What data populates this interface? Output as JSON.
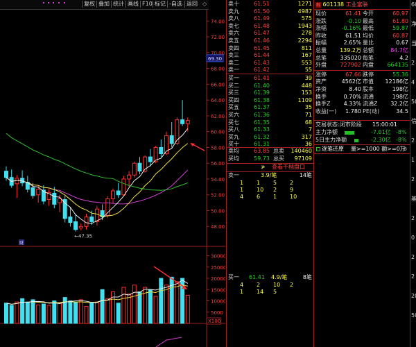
{
  "toolbar": {
    "items": [
      "复权",
      "叠加",
      "统计",
      "画线",
      "F10",
      "标记",
      "-自选",
      "返回"
    ],
    "diamond": "◇"
  },
  "chart": {
    "price_axis": [
      "74.00",
      "72.00",
      "70.00",
      "68.00",
      "66.00",
      "64.00",
      "62.00",
      "60.00",
      "58.00",
      "56.00",
      "54.00",
      "52.00",
      "50.00",
      "48.00"
    ],
    "price_tag": "69.30",
    "low_label": "←47.35",
    "cai_label": "财",
    "volume_axis": [
      "30000",
      "25000",
      "20000",
      "15000",
      "10000",
      "5000"
    ],
    "volume_unit": "X100",
    "colors": {
      "up": "#ff3030",
      "down": "#40e0f0",
      "ma5": "#f0f0f0",
      "ma10": "#f0e040",
      "ma20": "#d040d0",
      "ma60": "#30c030",
      "arrow": "#ff3030"
    }
  },
  "chart_data": {
    "type": "candlestick",
    "y_range": [
      46,
      75
    ],
    "candles": [
      {
        "o": 55.0,
        "h": 55.6,
        "l": 53.8,
        "c": 54.2
      },
      {
        "o": 54.2,
        "h": 55.2,
        "l": 52.9,
        "c": 53.2
      },
      {
        "o": 53.4,
        "h": 54.5,
        "l": 51.6,
        "c": 54.1
      },
      {
        "o": 54.1,
        "h": 55.1,
        "l": 53.1,
        "c": 53.5
      },
      {
        "o": 53.6,
        "h": 54.4,
        "l": 52.3,
        "c": 52.7
      },
      {
        "o": 52.9,
        "h": 53.5,
        "l": 51.5,
        "c": 51.9
      },
      {
        "o": 52.0,
        "h": 53.1,
        "l": 51.0,
        "c": 52.7
      },
      {
        "o": 52.6,
        "h": 53.2,
        "l": 50.8,
        "c": 51.2
      },
      {
        "o": 51.4,
        "h": 52.7,
        "l": 50.6,
        "c": 52.3
      },
      {
        "o": 52.2,
        "h": 53.0,
        "l": 50.3,
        "c": 50.8
      },
      {
        "o": 51.0,
        "h": 52.0,
        "l": 49.8,
        "c": 51.5
      },
      {
        "o": 51.4,
        "h": 51.9,
        "l": 48.5,
        "c": 49.0
      },
      {
        "o": 49.2,
        "h": 50.5,
        "l": 48.0,
        "c": 48.5
      },
      {
        "o": 48.6,
        "h": 49.5,
        "l": 47.35,
        "c": 47.6
      },
      {
        "o": 47.8,
        "h": 48.4,
        "l": 47.5,
        "c": 48.0
      },
      {
        "o": 48.0,
        "h": 49.6,
        "l": 47.6,
        "c": 49.2
      },
      {
        "o": 49.2,
        "h": 50.0,
        "l": 48.2,
        "c": 48.6
      },
      {
        "o": 48.6,
        "h": 50.6,
        "l": 48.1,
        "c": 50.2
      },
      {
        "o": 50.0,
        "h": 50.8,
        "l": 48.8,
        "c": 49.2
      },
      {
        "o": 49.4,
        "h": 51.8,
        "l": 49.1,
        "c": 51.5
      },
      {
        "o": 51.5,
        "h": 52.8,
        "l": 50.9,
        "c": 52.5
      },
      {
        "o": 52.5,
        "h": 53.5,
        "l": 51.6,
        "c": 52.0
      },
      {
        "o": 52.0,
        "h": 54.4,
        "l": 51.8,
        "c": 54.0
      },
      {
        "o": 54.0,
        "h": 55.0,
        "l": 53.0,
        "c": 54.5
      },
      {
        "o": 54.5,
        "h": 56.2,
        "l": 54.2,
        "c": 56.0
      },
      {
        "o": 56.0,
        "h": 56.8,
        "l": 54.6,
        "c": 55.0
      },
      {
        "o": 55.0,
        "h": 57.0,
        "l": 54.8,
        "c": 56.8
      },
      {
        "o": 56.8,
        "h": 57.8,
        "l": 55.6,
        "c": 56.2
      },
      {
        "o": 56.2,
        "h": 58.2,
        "l": 56.0,
        "c": 58.0
      },
      {
        "o": 58.0,
        "h": 59.0,
        "l": 56.8,
        "c": 57.2
      },
      {
        "o": 57.2,
        "h": 60.0,
        "l": 57.0,
        "c": 59.5
      },
      {
        "o": 59.5,
        "h": 61.2,
        "l": 58.0,
        "c": 58.5
      },
      {
        "o": 58.5,
        "h": 61.8,
        "l": 58.3,
        "c": 61.5
      },
      {
        "o": 61.5,
        "h": 64.0,
        "l": 60.7,
        "c": 61.0
      },
      {
        "o": 61.0,
        "h": 61.8,
        "l": 60.0,
        "c": 61.41
      }
    ],
    "volumes": [
      9000,
      8000,
      9500,
      11000,
      9500,
      10500,
      8200,
      8600,
      8000,
      10000,
      9000,
      11500,
      10000,
      9500,
      10500,
      7500,
      9000,
      9500,
      15000,
      11000,
      14000,
      9000,
      16000,
      13000,
      17000,
      14000,
      16000,
      15000,
      12000,
      20000,
      17000,
      20500,
      18500,
      20000,
      12500
    ]
  },
  "quotes": {
    "sells": [
      {
        "label": "卖十",
        "price": "61.51",
        "vol": "1271"
      },
      {
        "label": "卖九",
        "price": "61.50",
        "vol": "4987"
      },
      {
        "label": "卖八",
        "price": "61.49",
        "vol": "575"
      },
      {
        "label": "卖七",
        "price": "61.48",
        "vol": "1943"
      },
      {
        "label": "卖六",
        "price": "61.47",
        "vol": "278"
      },
      {
        "label": "卖五",
        "price": "61.46",
        "vol": "2294"
      },
      {
        "label": "卖四",
        "price": "61.45",
        "vol": "811"
      },
      {
        "label": "卖三",
        "price": "61.44",
        "vol": "167"
      },
      {
        "label": "卖二",
        "price": "61.43",
        "vol": "553"
      },
      {
        "label": "卖一",
        "price": "61.42",
        "vol": "55"
      }
    ],
    "buys": [
      {
        "label": "买一",
        "price": "61.41",
        "vol": "39"
      },
      {
        "label": "买二",
        "price": "61.40",
        "vol": "448"
      },
      {
        "label": "买三",
        "price": "61.39",
        "vol": "153"
      },
      {
        "label": "买四",
        "price": "61.38",
        "vol": "1109"
      },
      {
        "label": "买五",
        "price": "61.37",
        "vol": "35"
      },
      {
        "label": "买六",
        "price": "61.36",
        "vol": "71"
      },
      {
        "label": "买七",
        "price": "61.35",
        "vol": "68"
      },
      {
        "label": "买八",
        "price": "61.33",
        "vol": "7"
      },
      {
        "label": "买九",
        "price": "61.32",
        "vol": "317"
      },
      {
        "label": "买十",
        "price": "61.31",
        "vol": "36"
      }
    ],
    "avg_sell_label": "卖均",
    "avg_sell": "63.85",
    "total_sell_label": "总卖",
    "total_sell": "140460",
    "avg_buy_label": "买均",
    "avg_buy": "59.73",
    "total_buy_label": "总买",
    "total_buy": "97109",
    "queue_title": "查看千档盘口",
    "queue_mark": "≯",
    "sell1_queue": {
      "label": "卖一",
      "price": "3.9/笔",
      "count": "14笔",
      "rows": [
        [
          "1",
          "1",
          "5",
          "2"
        ],
        [
          "1",
          "10",
          "2",
          "9"
        ],
        [
          "4",
          "6",
          "1",
          "10"
        ]
      ]
    },
    "buy1_queue": {
      "label": "买一",
      "price": "61.41",
      "avg": "4.9/笔",
      "count": "8笔",
      "rows": [
        [
          "4",
          "2",
          "10",
          "2"
        ],
        [
          "1",
          "14",
          "5",
          ""
        ]
      ]
    }
  },
  "info": {
    "stock_icon": "融",
    "code": "601138",
    "name": "工业富联",
    "rows": [
      [
        {
          "k": "现价",
          "v": "61.41",
          "c": "red"
        },
        {
          "k": "今开",
          "v": "60.97",
          "c": "red"
        }
      ],
      [
        {
          "k": "涨跌",
          "v": "-0.10",
          "c": "grn"
        },
        {
          "k": "最高",
          "v": "61.80",
          "c": "red"
        }
      ],
      [
        {
          "k": "涨幅",
          "v": "-0.16%",
          "c": "grn"
        },
        {
          "k": "最低",
          "v": "59.87",
          "c": "grn"
        }
      ],
      [
        {
          "k": "昨收",
          "v": "61.51",
          "c": "wht"
        },
        {
          "k": "均价",
          "v": "60.87",
          "c": "red"
        }
      ],
      [
        {
          "k": "振幅",
          "v": "2.65%",
          "c": "wht"
        },
        {
          "k": "量比",
          "v": "0.67",
          "c": "wht"
        }
      ],
      [
        {
          "k": "总量",
          "v": "139.2万",
          "c": "yel"
        },
        {
          "k": "总额",
          "v": "84.7亿",
          "c": "mag"
        }
      ],
      [
        {
          "k": "总笔",
          "v": "335020",
          "c": "wht"
        },
        {
          "k": "每笔",
          "v": "4.2",
          "c": "wht"
        }
      ],
      [
        {
          "k": "外盘",
          "v": "727902",
          "c": "red"
        },
        {
          "k": "内盘",
          "v": "664135",
          "c": "grn"
        }
      ],
      [
        {
          "k": "涨停",
          "v": "67.66",
          "c": "red"
        },
        {
          "k": "跌停",
          "v": "55.36",
          "c": "grn"
        }
      ],
      [
        {
          "k": "资产",
          "v": "4562亿",
          "c": "wht"
        },
        {
          "k": "市值",
          "v": "12186亿",
          "c": "wht"
        }
      ],
      [
        {
          "k": "净资",
          "v": "8.40",
          "c": "wht"
        },
        {
          "k": "股本",
          "v": "198亿",
          "c": "wht"
        }
      ],
      [
        {
          "k": "换手",
          "v": "0.70%",
          "c": "wht"
        },
        {
          "k": "流通",
          "v": "198亿",
          "c": "wht"
        }
      ],
      [
        {
          "k": "换手Z",
          "v": "4.33%",
          "c": "wht"
        },
        {
          "k": "流通Z",
          "v": "32.2亿",
          "c": "wht"
        }
      ],
      [
        {
          "k": "收益(一)",
          "v": "1.780",
          "c": "wht"
        },
        {
          "k": "PE(动)",
          "v": "34.5",
          "c": "wht"
        }
      ]
    ],
    "status_label": "交易状态:闭市阶段",
    "status_time": "15:00:01",
    "flow1_label": "主力净额",
    "flow1_value": "-7.01亿",
    "flow1_pct": "-8%",
    "flow2_label": "5日主力净额",
    "flow2_value": "-2.30亿",
    "flow2_pct": "-8%",
    "filter_label": "逐笔还原",
    "filter_value": "量>=1000 额>=0万",
    "right_edge": [
      "60",
      "净",
      "当",
      "2",
      "4",
      "50",
      "信",
      "2",
      "1",
      "2",
      "基",
      "2",
      "0",
      "2",
      "2",
      "20",
      "50"
    ]
  }
}
